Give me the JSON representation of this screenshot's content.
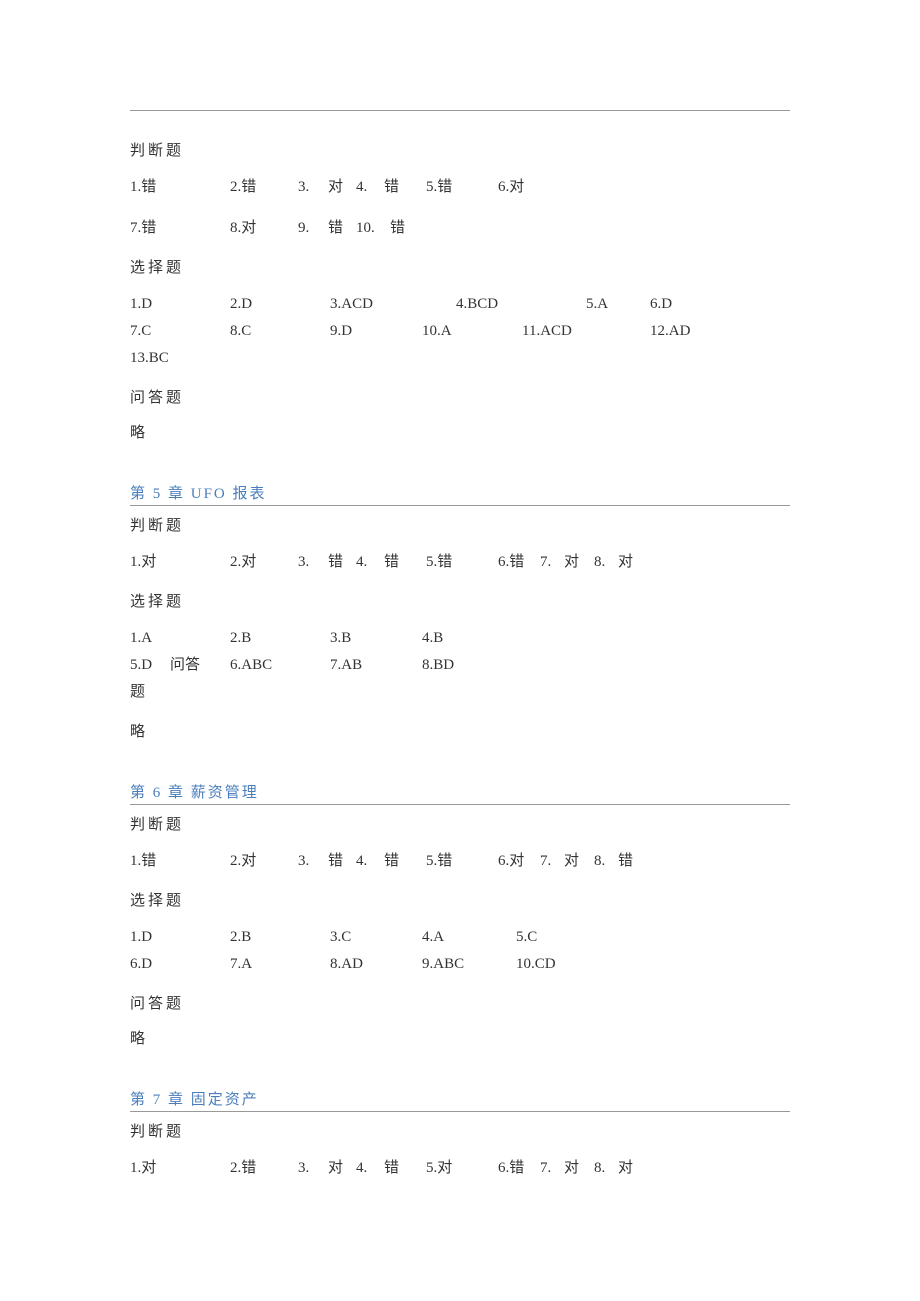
{
  "labels": {
    "judge": "判断题",
    "choice": "选择题",
    "qa": "问答题",
    "omit": "略"
  },
  "ch4": {
    "judge": [
      {
        "n": "1.",
        "v": "错"
      },
      {
        "n": "2.",
        "v": "错"
      },
      {
        "n": "3.",
        "v": "对"
      },
      {
        "n": "4.",
        "v": "错"
      },
      {
        "n": "5.",
        "v": "错"
      },
      {
        "n": "6.",
        "v": "对"
      },
      {
        "n": "7.",
        "v": "错"
      },
      {
        "n": "8.",
        "v": "对"
      },
      {
        "n": "9.",
        "v": "错"
      },
      {
        "n": "10.",
        "v": "错"
      }
    ],
    "choice": [
      {
        "n": "1.",
        "v": "D"
      },
      {
        "n": "2.",
        "v": "D"
      },
      {
        "n": "3.",
        "v": "ACD"
      },
      {
        "n": "4.",
        "v": "BCD"
      },
      {
        "n": "5.",
        "v": "A"
      },
      {
        "n": "6.",
        "v": "D"
      },
      {
        "n": "7.",
        "v": "C"
      },
      {
        "n": "8.",
        "v": "C"
      },
      {
        "n": "9.",
        "v": "D"
      },
      {
        "n": "10.",
        "v": "A"
      },
      {
        "n": "11.",
        "v": "ACD"
      },
      {
        "n": "12.",
        "v": "AD"
      },
      {
        "n": "13.",
        "v": "BC"
      }
    ]
  },
  "ch5": {
    "title": "第 5 章   UFO 报表",
    "judge": [
      {
        "n": "1.",
        "v": "对"
      },
      {
        "n": "2.",
        "v": "对"
      },
      {
        "n": "3.",
        "v": "错"
      },
      {
        "n": "4.",
        "v": "错"
      },
      {
        "n": "5.",
        "v": "错"
      },
      {
        "n": "6.",
        "v": "错"
      },
      {
        "n": "7.",
        "v": "对"
      },
      {
        "n": "8.",
        "v": "对"
      }
    ],
    "choice": [
      {
        "n": "1.",
        "v": "A"
      },
      {
        "n": "2.",
        "v": "B"
      },
      {
        "n": "3.",
        "v": "B"
      },
      {
        "n": "4.",
        "v": "B"
      },
      {
        "n": "5.",
        "v": "D"
      },
      {
        "n": "6.",
        "v": "ABC"
      },
      {
        "n": "7.",
        "v": "AB"
      },
      {
        "n": "8.",
        "v": "BD"
      }
    ],
    "qa_inline": "问答"
  },
  "ch6": {
    "title": "第 6 章   薪资管理",
    "judge": [
      {
        "n": "1.",
        "v": "错"
      },
      {
        "n": "2.",
        "v": "对"
      },
      {
        "n": "3.",
        "v": "错"
      },
      {
        "n": "4.",
        "v": "错"
      },
      {
        "n": "5.",
        "v": "错"
      },
      {
        "n": "6.",
        "v": "对"
      },
      {
        "n": "7.",
        "v": "对"
      },
      {
        "n": "8.",
        "v": "错"
      }
    ],
    "choice": [
      {
        "n": "1.",
        "v": "D"
      },
      {
        "n": "2.",
        "v": "B"
      },
      {
        "n": "3.",
        "v": "C"
      },
      {
        "n": "4.",
        "v": "A"
      },
      {
        "n": "5.",
        "v": "C"
      },
      {
        "n": "6.",
        "v": "D"
      },
      {
        "n": "7.",
        "v": "A"
      },
      {
        "n": "8.",
        "v": "AD"
      },
      {
        "n": "9.",
        "v": "ABC"
      },
      {
        "n": "10.",
        "v": "CD"
      }
    ]
  },
  "ch7": {
    "title": "第 7 章   固定资产",
    "judge": [
      {
        "n": "1.",
        "v": "对"
      },
      {
        "n": "2.",
        "v": "错"
      },
      {
        "n": "3.",
        "v": "对"
      },
      {
        "n": "4.",
        "v": "错"
      },
      {
        "n": "5.",
        "v": "对"
      },
      {
        "n": "6.",
        "v": "错"
      },
      {
        "n": "7.",
        "v": "对"
      },
      {
        "n": "8.",
        "v": "对"
      }
    ]
  }
}
